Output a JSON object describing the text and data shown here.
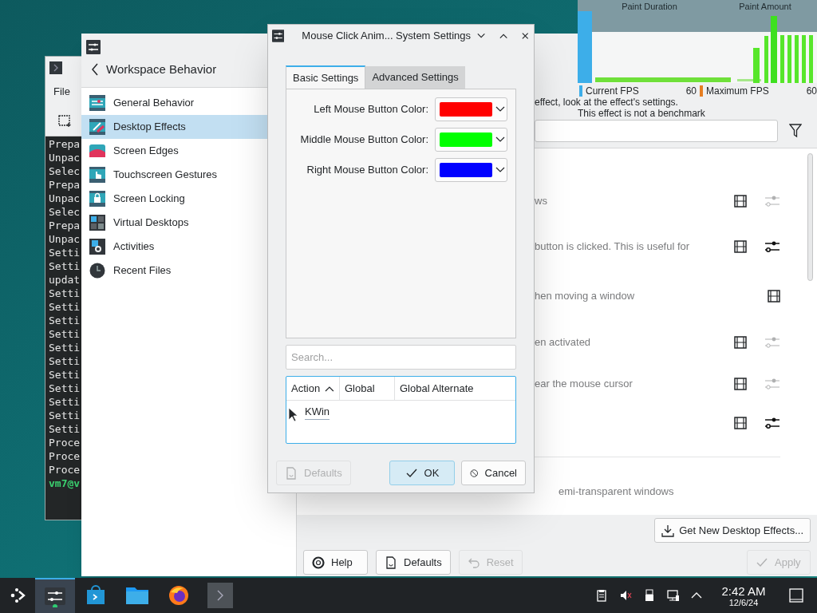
{
  "terminal": {
    "menu": [
      "File"
    ],
    "lines": [
      "Prepa",
      "Unpac",
      "Selec",
      "Prepa",
      "Unpac",
      "Selec",
      "Prepa",
      "Unpac",
      "Setti",
      "Setti",
      "updat",
      "Setti",
      "Setti",
      "Setti",
      "Setti",
      "Setti",
      "Setti",
      "Setti",
      "Setti",
      "Setti",
      "Setti",
      "Setti",
      "Proce",
      "Proce",
      "Proce"
    ],
    "prompt": "vm7@v"
  },
  "settings": {
    "header": "Workspace Behavior",
    "sidebar": [
      {
        "label": "General Behavior",
        "selected": false
      },
      {
        "label": "Desktop Effects",
        "selected": true
      },
      {
        "label": "Screen Edges",
        "selected": false
      },
      {
        "label": "Touchscreen Gestures",
        "selected": false
      },
      {
        "label": "Screen Locking",
        "selected": false
      },
      {
        "label": "Virtual Desktops",
        "selected": false
      },
      {
        "label": "Activities",
        "selected": false
      },
      {
        "label": "Recent Files",
        "selected": false
      }
    ],
    "hint": "effect, look at the effect's settings.",
    "effects": [
      {
        "description": "ws",
        "configure": true,
        "highlight": false
      },
      {
        "description": "button is clicked. This is useful for",
        "configure": true,
        "highlight": true
      },
      {
        "description": "hen moving a window",
        "configure": false
      },
      {
        "description": "en activated",
        "configure": true,
        "highlight": false
      },
      {
        "description": "ear the mouse cursor",
        "configure": true,
        "highlight": false
      },
      {
        "configure": true,
        "highlight": true
      }
    ],
    "footer_text": "emi-transparent windows",
    "get_new": "Get New Desktop Effects...",
    "buttons": [
      {
        "label": "Help",
        "kind": "help",
        "disabled": false
      },
      {
        "label": "Defaults",
        "kind": "defaults",
        "disabled": false
      },
      {
        "label": "Reset",
        "kind": "reset",
        "disabled": true
      },
      {
        "label": "Apply",
        "kind": "apply",
        "disabled": true
      }
    ]
  },
  "fps_overlay": {
    "titles": [
      "Paint Duration",
      "Paint Amount"
    ],
    "stats": [
      {
        "label": "Current FPS",
        "value": "60",
        "color": "#3daee9"
      },
      {
        "label": "Maximum FPS",
        "value": "60",
        "color": "#e67e22"
      }
    ],
    "note": "This effect is not a benchmark"
  },
  "dialog": {
    "title": "Mouse Click Anim... System Settings",
    "tabs": [
      {
        "label": "Basic Settings",
        "selected": true
      },
      {
        "label": "Advanced Settings",
        "selected": false
      }
    ],
    "colors": [
      {
        "label": "Left Mouse Button Color:",
        "color": "#ff0000"
      },
      {
        "label": "Middle Mouse Button Color:",
        "color": "#00ff00"
      },
      {
        "label": "Right Mouse Button Color:",
        "color": "#0000ff"
      }
    ],
    "search": {
      "placeholder": "Search..."
    },
    "columns": [
      "Action",
      "Global",
      "Global Alternate"
    ],
    "rows": [
      "KWin"
    ],
    "buttons": [
      {
        "label": "Defaults",
        "kind": "defaults",
        "disabled": true
      },
      {
        "label": "OK",
        "kind": "ok",
        "disabled": false
      },
      {
        "label": "Cancel",
        "kind": "cancel",
        "disabled": false
      }
    ]
  },
  "taskbar": {
    "time": "2:42 AM",
    "date": "12/6/24"
  }
}
